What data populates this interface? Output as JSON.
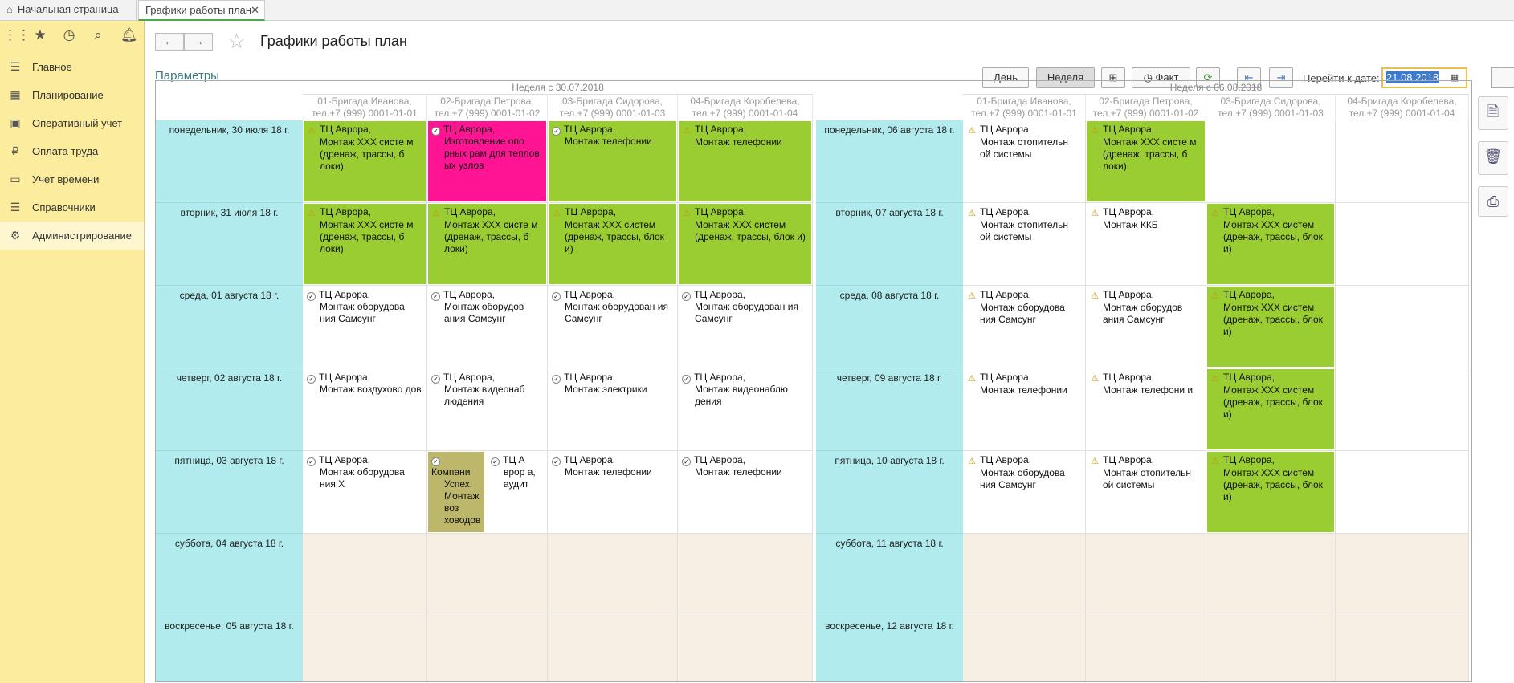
{
  "tabs": {
    "home": "Начальная страница",
    "active": "Графики работы план"
  },
  "sidebar": [
    {
      "label": "Главное",
      "icon": "menu-icon"
    },
    {
      "label": "Планирование",
      "icon": "calendar-icon"
    },
    {
      "label": "Оперативный учет",
      "icon": "clipboard-icon"
    },
    {
      "label": "Оплата труда",
      "icon": "ruble-icon"
    },
    {
      "label": "Учет времени",
      "icon": "monitor-icon"
    },
    {
      "label": "Справочники",
      "icon": "list-icon"
    },
    {
      "label": "Администрирование",
      "icon": "gear-icon"
    }
  ],
  "page": {
    "title": "Графики работы план",
    "params": "Параметры"
  },
  "toolbar": {
    "day": "День",
    "week": "Неделя",
    "fact": "Факт",
    "goto_label": "Перейти к дате:",
    "date": "21.08.2018"
  },
  "weeks": [
    {
      "title": "Неделя с 30.07.2018",
      "columns": [
        "01-Бригада Иванова, тел.+7 (999) 0001-01-01",
        "02-Бригада Петрова, тел.+7 (999) 0001-01-02",
        "03-Бригада Сидорова, тел.+7 (999) 0001-01-03",
        "04-Бригада Коробелева, тел.+7 (999) 0001-01-04"
      ],
      "days": [
        "понедельник, 30 июля 18 г.",
        "вторник, 31 июля 18 г.",
        "среда, 01 августа 18 г.",
        "четверг, 02 августа 18 г.",
        "пятница, 03 августа 18 г.",
        "суббота, 04 августа 18 г.",
        "воскресенье, 05 августа 18 г."
      ]
    },
    {
      "title": "Неделя с 06.08.2018",
      "columns": [
        "01-Бригада Иванова, тел.+7 (999) 0001-01-01",
        "02-Бригада Петрова, тел.+7 (999) 0001-01-02",
        "03-Бригада Сидорова, тел.+7 (999) 0001-01-03",
        "04-Бригада Коробелева, тел.+7 (999) 0001-01-04"
      ],
      "days": [
        "понедельник, 06 августа 18 г.",
        "вторник, 07 августа 18 г.",
        "среда, 08 августа 18 г.",
        "четверг, 09 августа 18 г.",
        "пятница, 10 августа 18 г.",
        "суббота, 11 августа 18 г.",
        "воскресенье, 12 августа 18 г."
      ]
    }
  ],
  "colors": {
    "green": "#9acd32",
    "pink": "#ff1493",
    "olive": "#bdb76b",
    "day": "#b2ebed",
    "weekend": "#f7eee4"
  },
  "events": [
    {
      "w": 0,
      "c": 0,
      "d": 0,
      "color": "green",
      "icon": "warn",
      "l1": "ТЦ Аврора,",
      "l2": "Монтаж XXX систе м (дренаж, трассы, б локи)"
    },
    {
      "w": 0,
      "c": 1,
      "d": 0,
      "color": "pink",
      "icon": "check",
      "l1": "ТЦ Аврора,",
      "l2": "Изготовление опо рных рам для теплов ых узлов"
    },
    {
      "w": 0,
      "c": 2,
      "d": 0,
      "color": "green",
      "icon": "check",
      "l1": "ТЦ Аврора,",
      "l2": "Монтаж телефонии"
    },
    {
      "w": 0,
      "c": 3,
      "d": 0,
      "color": "green",
      "icon": "warn",
      "l1": "ТЦ Аврора,",
      "l2": "Монтаж телефонии"
    },
    {
      "w": 0,
      "c": 0,
      "d": 1,
      "color": "green",
      "icon": "warn",
      "l1": "ТЦ Аврора,",
      "l2": "Монтаж XXX систе м (дренаж, трассы, б локи)"
    },
    {
      "w": 0,
      "c": 1,
      "d": 1,
      "color": "green",
      "icon": "warn",
      "l1": "ТЦ Аврора,",
      "l2": "Монтаж XXX систе м (дренаж, трассы, б локи)"
    },
    {
      "w": 0,
      "c": 2,
      "d": 1,
      "color": "green",
      "icon": "warn",
      "l1": "ТЦ Аврора,",
      "l2": "Монтаж XXX систем (дренаж, трассы, блок и)"
    },
    {
      "w": 0,
      "c": 3,
      "d": 1,
      "color": "green",
      "icon": "warn",
      "l1": "ТЦ Аврора,",
      "l2": "Монтаж XXX систем (дренаж, трассы, блок и)"
    },
    {
      "w": 0,
      "c": 0,
      "d": 2,
      "color": "",
      "icon": "check",
      "l1": "ТЦ Аврора,",
      "l2": "Монтаж оборудова ния Самсунг"
    },
    {
      "w": 0,
      "c": 1,
      "d": 2,
      "color": "",
      "icon": "check",
      "l1": "ТЦ Аврора,",
      "l2": "Монтаж оборудов ания Самсунг"
    },
    {
      "w": 0,
      "c": 2,
      "d": 2,
      "color": "",
      "icon": "check",
      "l1": "ТЦ Аврора,",
      "l2": "Монтаж оборудован ия Самсунг"
    },
    {
      "w": 0,
      "c": 3,
      "d": 2,
      "color": "",
      "icon": "check",
      "l1": "ТЦ Аврора,",
      "l2": "Монтаж оборудован ия Самсунг"
    },
    {
      "w": 0,
      "c": 0,
      "d": 3,
      "color": "",
      "icon": "check",
      "l1": "ТЦ Аврора,",
      "l2": "Монтаж воздухово дов"
    },
    {
      "w": 0,
      "c": 1,
      "d": 3,
      "color": "",
      "icon": "check",
      "l1": "ТЦ Аврора,",
      "l2": "Монтаж видеонаб людения"
    },
    {
      "w": 0,
      "c": 2,
      "d": 3,
      "color": "",
      "icon": "check",
      "l1": "ТЦ Аврора,",
      "l2": "Монтаж электрики"
    },
    {
      "w": 0,
      "c": 3,
      "d": 3,
      "color": "",
      "icon": "check",
      "l1": "ТЦ Аврора,",
      "l2": "Монтаж видеонаблю дения"
    },
    {
      "w": 0,
      "c": 0,
      "d": 4,
      "color": "",
      "icon": "check",
      "l1": "ТЦ Аврора,",
      "l2": "Монтаж оборудова ния X"
    },
    {
      "w": 0,
      "c": 1,
      "d": 4,
      "color": "olive",
      "icon": "check",
      "half": "left",
      "l1": "Компани",
      "l2": "Успех, Монтаж воз ховодов"
    },
    {
      "w": 0,
      "c": 1,
      "d": 4,
      "color": "",
      "icon": "check",
      "half": "right",
      "l1": "ТЦ А",
      "l2": "врор а, аудит"
    },
    {
      "w": 0,
      "c": 2,
      "d": 4,
      "color": "",
      "icon": "check",
      "l1": "ТЦ Аврора,",
      "l2": "Монтаж телефонии"
    },
    {
      "w": 0,
      "c": 3,
      "d": 4,
      "color": "",
      "icon": "check",
      "l1": "ТЦ Аврора,",
      "l2": "Монтаж телефонии"
    },
    {
      "w": 1,
      "c": 0,
      "d": 0,
      "color": "",
      "icon": "warn",
      "l1": "ТЦ Аврора,",
      "l2": "Монтаж отопительн ой системы"
    },
    {
      "w": 1,
      "c": 1,
      "d": 0,
      "color": "green",
      "icon": "warn",
      "l1": "ТЦ Аврора,",
      "l2": "Монтаж XXX систе м (дренаж, трассы, б локи)"
    },
    {
      "w": 1,
      "c": 0,
      "d": 1,
      "color": "",
      "icon": "warn",
      "l1": "ТЦ Аврора,",
      "l2": "Монтаж отопительн ой системы"
    },
    {
      "w": 1,
      "c": 1,
      "d": 1,
      "color": "",
      "icon": "warn",
      "l1": "ТЦ Аврора,",
      "l2": "Монтаж ККБ"
    },
    {
      "w": 1,
      "c": 2,
      "d": 1,
      "color": "green",
      "icon": "warn",
      "l1": "ТЦ Аврора,",
      "l2": "Монтаж XXX систем (дренаж, трассы, блок и)"
    },
    {
      "w": 1,
      "c": 0,
      "d": 2,
      "color": "",
      "icon": "warn",
      "l1": "ТЦ Аврора,",
      "l2": "Монтаж оборудова ния Самсунг"
    },
    {
      "w": 1,
      "c": 1,
      "d": 2,
      "color": "",
      "icon": "warn",
      "l1": "ТЦ Аврора,",
      "l2": "Монтаж оборудов ания Самсунг"
    },
    {
      "w": 1,
      "c": 2,
      "d": 2,
      "color": "green",
      "icon": "warn",
      "l1": "ТЦ Аврора,",
      "l2": "Монтаж XXX систем (дренаж, трассы, блок и)"
    },
    {
      "w": 1,
      "c": 0,
      "d": 3,
      "color": "",
      "icon": "warn",
      "l1": "ТЦ Аврора,",
      "l2": "Монтаж телефонии"
    },
    {
      "w": 1,
      "c": 1,
      "d": 3,
      "color": "",
      "icon": "warn",
      "l1": "ТЦ Аврора,",
      "l2": "Монтаж телефони и"
    },
    {
      "w": 1,
      "c": 2,
      "d": 3,
      "color": "green",
      "icon": "warn",
      "l1": "ТЦ Аврора,",
      "l2": "Монтаж XXX систем (дренаж, трассы, блок и)"
    },
    {
      "w": 1,
      "c": 0,
      "d": 4,
      "color": "",
      "icon": "warn",
      "l1": "ТЦ Аврора,",
      "l2": "Монтаж оборудова ния Самсунг"
    },
    {
      "w": 1,
      "c": 1,
      "d": 4,
      "color": "",
      "icon": "warn",
      "l1": "ТЦ Аврора,",
      "l2": "Монтаж отопительн ой системы"
    },
    {
      "w": 1,
      "c": 2,
      "d": 4,
      "color": "green",
      "icon": "warn",
      "l1": "ТЦ Аврора,",
      "l2": "Монтаж XXX систем (дренаж, трассы, блок и)"
    }
  ]
}
